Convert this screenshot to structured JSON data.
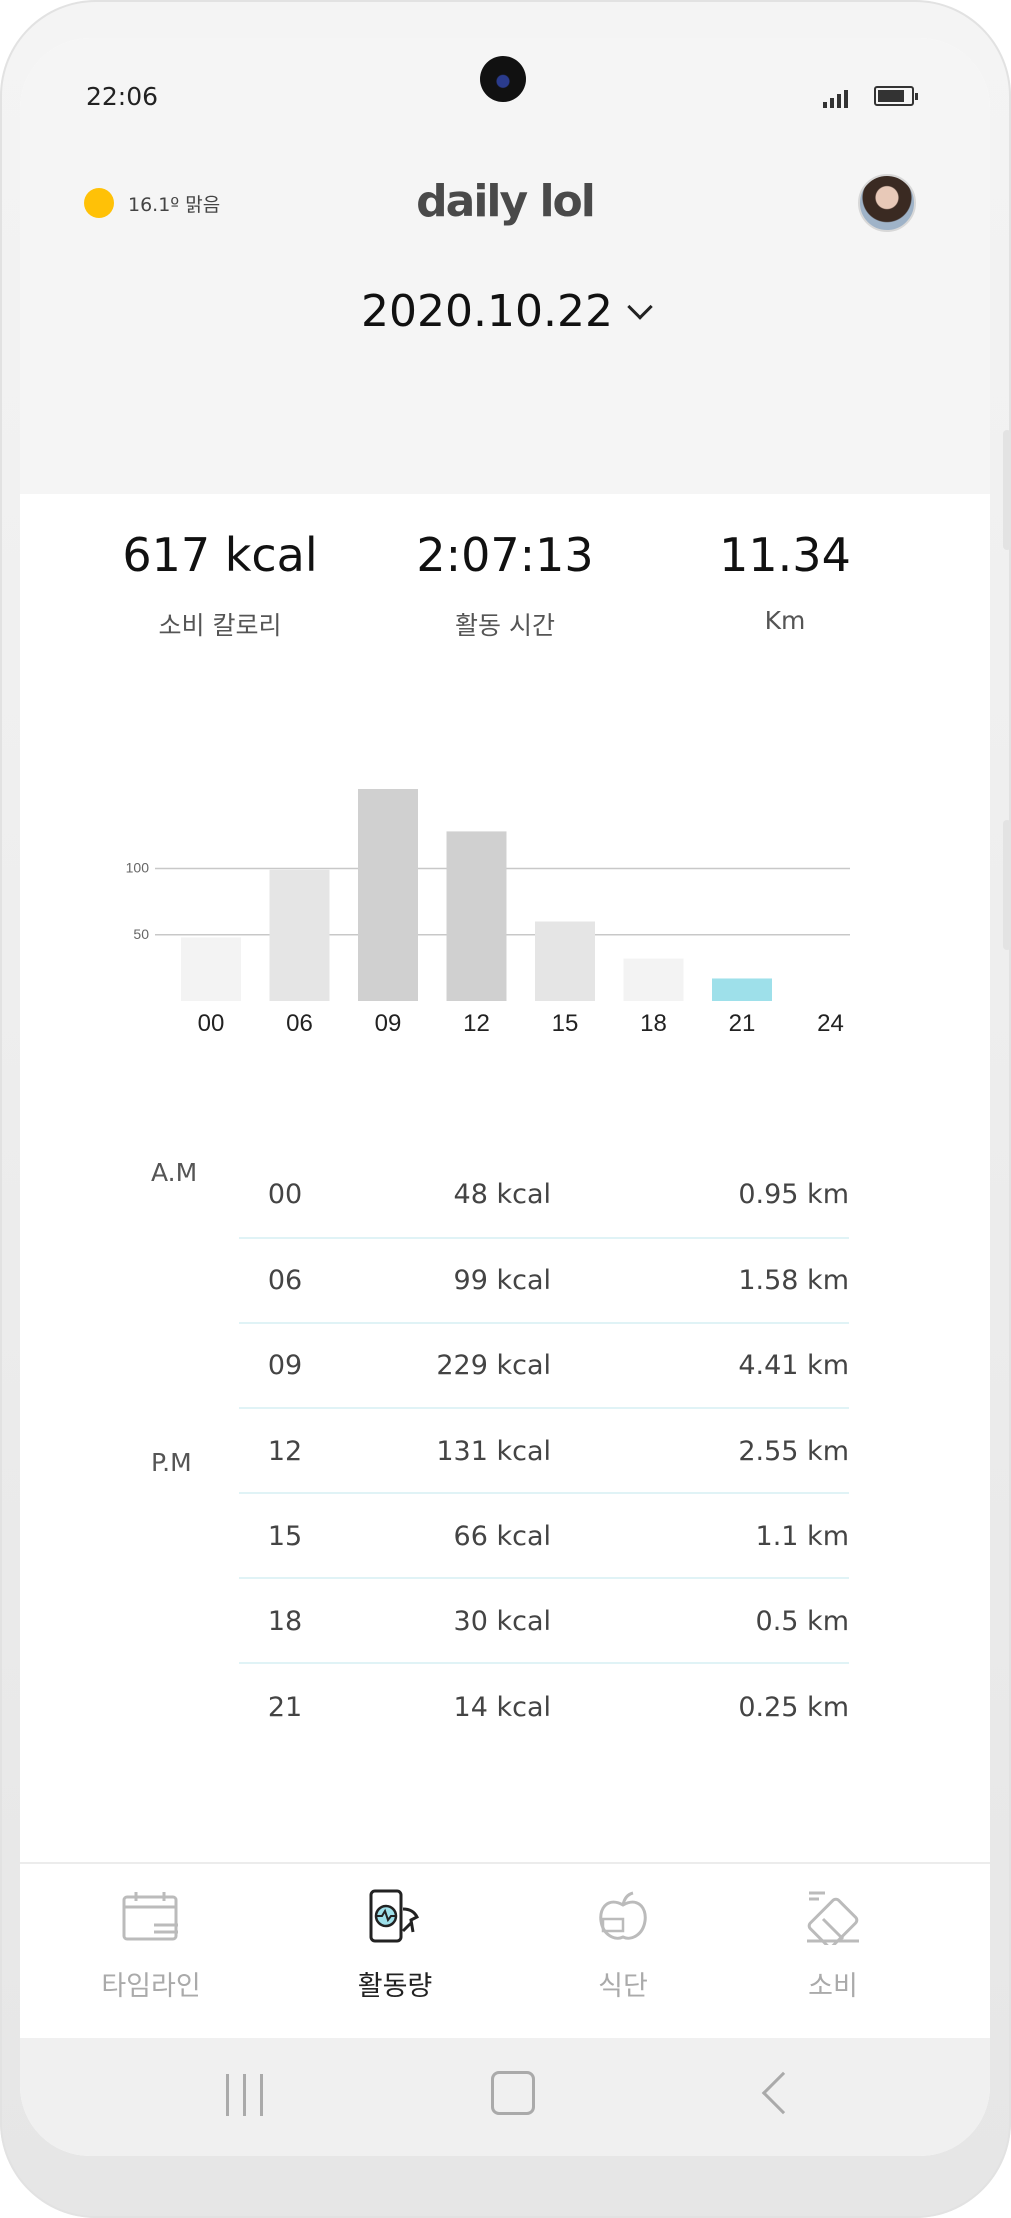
{
  "status_bar": {
    "time": "22:06"
  },
  "header": {
    "weather": "16.1º 맑음",
    "logo": "daily lol",
    "date": "2020.10.22"
  },
  "summary": [
    {
      "value": "617 kcal",
      "label": "소비 칼로리"
    },
    {
      "value": "2:07:13",
      "label": "활동 시간"
    },
    {
      "value": "11.34",
      "label": "Km"
    }
  ],
  "chart_data": {
    "type": "bar",
    "categories": [
      "00",
      "06",
      "09",
      "12",
      "15",
      "18",
      "21",
      "24"
    ],
    "values": [
      48,
      99,
      160,
      128,
      60,
      32,
      17,
      0
    ],
    "y_ticks": [
      50,
      100
    ],
    "ylim": [
      0,
      160
    ],
    "highlight_index": 6,
    "colors": [
      "#f3f3f3",
      "#e5e5e5",
      "#d0d0d0",
      "#d0d0d0",
      "#e5e5e5",
      "#f3f3f3",
      "#9ee0ea",
      "#f3f3f3"
    ]
  },
  "table": {
    "am_label": "A.M",
    "pm_label": "P.M",
    "rows": [
      {
        "hour": "00",
        "kcal": "48 kcal",
        "km": "0.95 km"
      },
      {
        "hour": "06",
        "kcal": "99 kcal",
        "km": "1.58 km"
      },
      {
        "hour": "09",
        "kcal": "229 kcal",
        "km": "4.41 km"
      },
      {
        "hour": "12",
        "kcal": "131 kcal",
        "km": "2.55 km"
      },
      {
        "hour": "15",
        "kcal": "66 kcal",
        "km": "1.1 km"
      },
      {
        "hour": "18",
        "kcal": "30 kcal",
        "km": "0.5 km"
      },
      {
        "hour": "21",
        "kcal": "14 kcal",
        "km": "0.25 km"
      }
    ]
  },
  "nav": [
    {
      "label": "타임라인",
      "icon": "calendar-icon",
      "active": false
    },
    {
      "label": "활동량",
      "icon": "activity-icon",
      "active": true
    },
    {
      "label": "식단",
      "icon": "apple-icon",
      "active": false
    },
    {
      "label": "소비",
      "icon": "card-icon",
      "active": false
    }
  ]
}
